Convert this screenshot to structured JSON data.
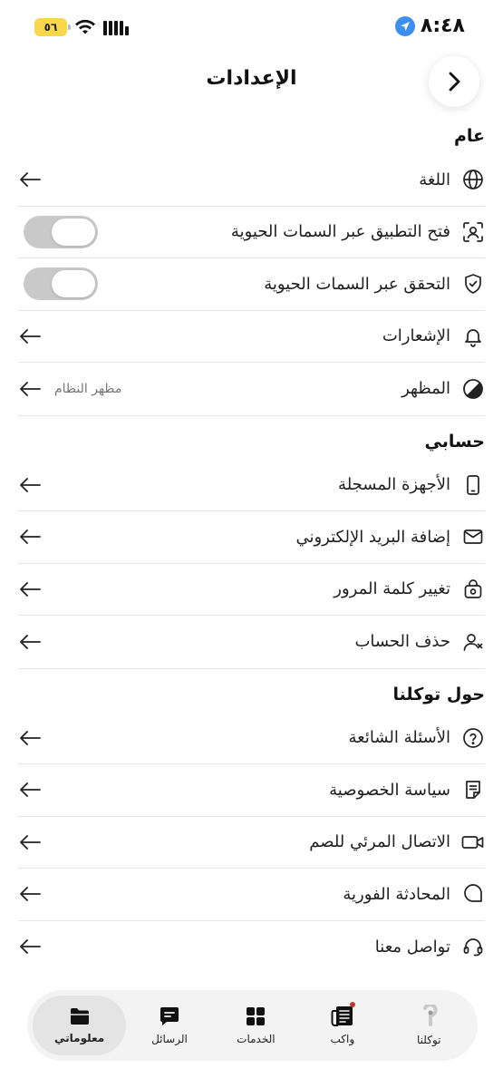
{
  "status_bar": {
    "time": "٨:٤٨",
    "battery": "٥٦"
  },
  "header": {
    "title": "الإعدادات"
  },
  "sections": {
    "general": {
      "title": "عام",
      "language": "اللغة",
      "biometric_open": "فتح التطبيق عبر السمات الحيوية",
      "biometric_verify": "التحقق عبر السمات الحيوية",
      "notifications": "الإشعارات",
      "appearance": "المظهر",
      "appearance_value": "مظهر النظام"
    },
    "account": {
      "title": "حسابي",
      "devices": "الأجهزة المسجلة",
      "add_email": "إضافة البريد الإلكتروني",
      "change_password": "تغيير كلمة المرور",
      "delete_account": "حذف الحساب"
    },
    "about": {
      "title": "حول توكلنا",
      "faq": "الأسئلة الشائعة",
      "privacy": "سياسة الخصوصية",
      "video_call": "الاتصال المرئي للصم",
      "live_chat": "المحادثة الفورية",
      "contact": "تواصل معنا"
    }
  },
  "toggles": {
    "biometric_open": false,
    "biometric_verify": false
  },
  "nav": {
    "tawakkalna": "توكلنا",
    "wakeb": "واكب",
    "services": "الخدمات",
    "messages": "الرسائل",
    "my_info": "معلوماتي"
  }
}
